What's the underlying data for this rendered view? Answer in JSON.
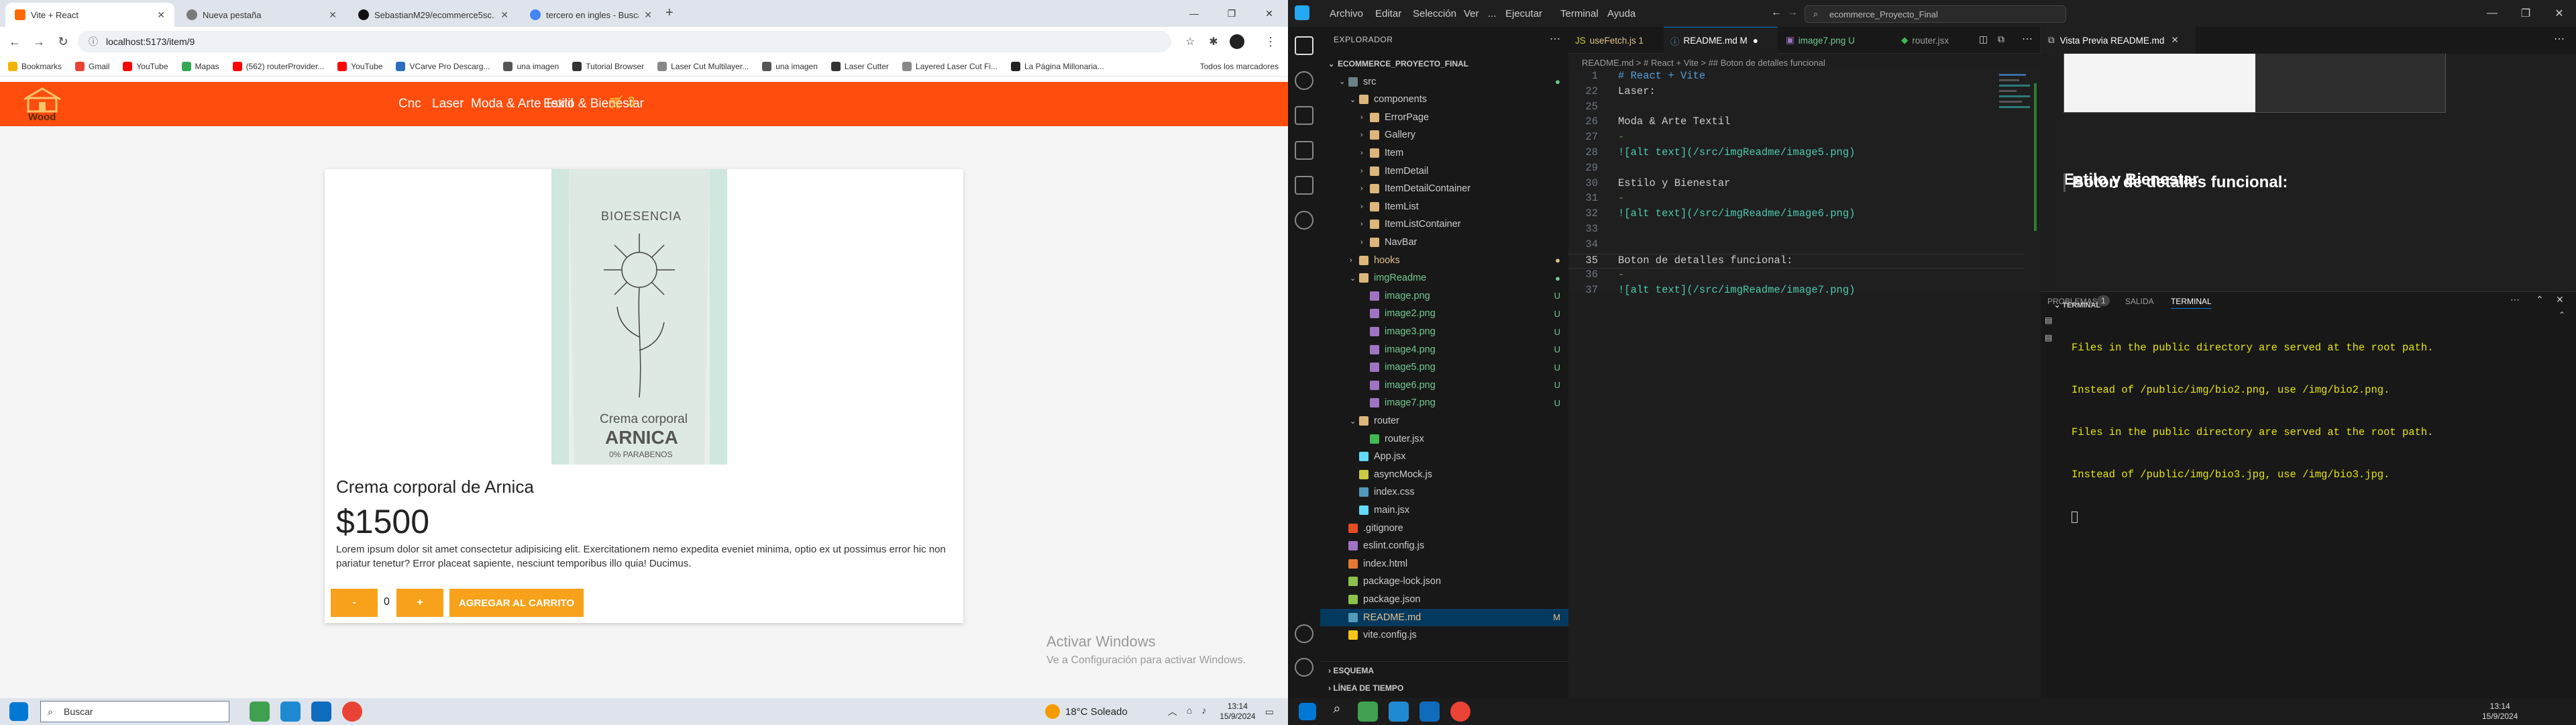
{
  "chrome": {
    "tabs": [
      {
        "label": "Vite + React",
        "color": "#ff6a00"
      },
      {
        "label": "Nueva pestaña",
        "color": "#7a7a7a"
      },
      {
        "label": "SebastianM29/ecommerce5sc...",
        "color": "#111111"
      },
      {
        "label": "tercero en ingles - Buscar con...",
        "color": "#4285f4"
      }
    ],
    "new_tab": "+",
    "url": "localhost:5173/item/9",
    "bookmarks": [
      {
        "label": "Bookmarks",
        "color": "#f2b400"
      },
      {
        "label": "Gmail",
        "color": "#ea4335"
      },
      {
        "label": "YouTube",
        "color": "#ff0000"
      },
      {
        "label": "Mapas",
        "color": "#34a853"
      },
      {
        "label": "(562) routerProvider...",
        "color": "#ff0000"
      },
      {
        "label": "YouTube",
        "color": "#ff0000"
      },
      {
        "label": "VCarve Pro Descarg...",
        "color": "#2a6ebb"
      },
      {
        "label": "una imagen",
        "color": "#555555"
      },
      {
        "label": "Tutorial Browser",
        "color": "#333333"
      },
      {
        "label": "Laser Cut Multilayer...",
        "color": "#888888"
      },
      {
        "label": "una imagen",
        "color": "#555555"
      },
      {
        "label": "Laser Cutter",
        "color": "#333333"
      },
      {
        "label": "Layered Laser Cut Fi...",
        "color": "#888888"
      },
      {
        "label": "La Página Millonaria...",
        "color": "#222222"
      }
    ],
    "bookmarks_all": "Todos los marcadores"
  },
  "site": {
    "brand": "Wood",
    "nav": [
      "Cnc",
      "Laser",
      "Moda & Arte Textil",
      "Estilo & Bienestar"
    ],
    "cart_count": "3",
    "product": {
      "image_brand": "BIOESENCIA",
      "image_text1": "Crema corporal",
      "image_text2": "ARNICA",
      "image_text3": "0% PARABENOS",
      "name": "Crema corporal de Arnica",
      "price": "$1500",
      "description": "Lorem ipsum dolor sit amet consectetur adipisicing elit. Exercitationem nemo expedita eveniet minima, optio ex ut possimus error hic non pariatur tenetur? Error placeat sapiente, nesciunt temporibus illo quia! Ducimus.",
      "minus": "-",
      "quantity": "0",
      "plus": "+",
      "add_to_cart": "AGREGAR AL CARRITO"
    },
    "watermark_title": "Activar Windows",
    "watermark_sub": "Ve a Configuración para activar Windows."
  },
  "taskbar_left": {
    "search": "Buscar",
    "weather": "18°C   Soleado",
    "time": "13:14",
    "date": "15/9/2024"
  },
  "taskbar_right": {
    "time": "13:14",
    "date": "15/9/2024"
  },
  "vscode": {
    "menu": [
      "Archivo",
      "Editar",
      "Selección",
      "Ver",
      "...",
      "Ejecutar",
      "Terminal",
      "Ayuda"
    ],
    "command_center": "ecommerce_Proyecto_Final",
    "explorer_title": "EXPLORADOR",
    "tree": [
      {
        "label": "ECOMMERCE_PROYECTO_FINAL",
        "indent": 0,
        "color": "#cccccc",
        "badge": "",
        "icon": "#cccccc"
      },
      {
        "label": "src",
        "indent": 1,
        "color": "#cccccc",
        "badge": "●",
        "badgeColor": "#73c991",
        "icon": "#6d8086"
      },
      {
        "label": "components",
        "indent": 2,
        "color": "#cccccc",
        "badge": "",
        "icon": "#dcb67a"
      },
      {
        "label": "ErrorPage",
        "indent": 3,
        "color": "#cccccc",
        "badge": "",
        "icon": "#dcb67a"
      },
      {
        "label": "Gallery",
        "indent": 3,
        "color": "#cccccc",
        "badge": "",
        "icon": "#dcb67a"
      },
      {
        "label": "Item",
        "indent": 3,
        "color": "#cccccc",
        "badge": "",
        "icon": "#dcb67a"
      },
      {
        "label": "ItemDetail",
        "indent": 3,
        "color": "#cccccc",
        "badge": "",
        "icon": "#dcb67a"
      },
      {
        "label": "ItemDetailContainer",
        "indent": 3,
        "color": "#cccccc",
        "badge": "",
        "icon": "#dcb67a"
      },
      {
        "label": "ItemList",
        "indent": 3,
        "color": "#cccccc",
        "badge": "",
        "icon": "#dcb67a"
      },
      {
        "label": "ItemListContainer",
        "indent": 3,
        "color": "#cccccc",
        "badge": "",
        "icon": "#dcb67a"
      },
      {
        "label": "NavBar",
        "indent": 3,
        "color": "#cccccc",
        "badge": "",
        "icon": "#dcb67a"
      },
      {
        "label": "hooks",
        "indent": 2,
        "color": "#e2c08d",
        "badge": "●",
        "badgeColor": "#e2c08d",
        "icon": "#dcb67a"
      },
      {
        "label": "imgReadme",
        "indent": 2,
        "color": "#73c991",
        "badge": "●",
        "badgeColor": "#73c991",
        "icon": "#dcb67a"
      },
      {
        "label": "image.png",
        "indent": 3,
        "color": "#73c991",
        "badge": "U",
        "badgeColor": "#73c991",
        "icon": "#a074c4"
      },
      {
        "label": "image2.png",
        "indent": 3,
        "color": "#73c991",
        "badge": "U",
        "badgeColor": "#73c991",
        "icon": "#a074c4"
      },
      {
        "label": "image3.png",
        "indent": 3,
        "color": "#73c991",
        "badge": "U",
        "badgeColor": "#73c991",
        "icon": "#a074c4"
      },
      {
        "label": "image4.png",
        "indent": 3,
        "color": "#73c991",
        "badge": "U",
        "badgeColor": "#73c991",
        "icon": "#a074c4"
      },
      {
        "label": "image5.png",
        "indent": 3,
        "color": "#73c991",
        "badge": "U",
        "badgeColor": "#73c991",
        "icon": "#a074c4"
      },
      {
        "label": "image6.png",
        "indent": 3,
        "color": "#73c991",
        "badge": "U",
        "badgeColor": "#73c991",
        "icon": "#a074c4"
      },
      {
        "label": "image7.png",
        "indent": 3,
        "color": "#73c991",
        "badge": "U",
        "badgeColor": "#73c991",
        "icon": "#a074c4"
      },
      {
        "label": "router",
        "indent": 2,
        "color": "#cccccc",
        "badge": "",
        "icon": "#dcb67a"
      },
      {
        "label": "router.jsx",
        "indent": 3,
        "color": "#cccccc",
        "badge": "",
        "icon": "#3fb950"
      },
      {
        "label": "App.jsx",
        "indent": 2,
        "color": "#cccccc",
        "badge": "",
        "icon": "#61dafb"
      },
      {
        "label": "asyncMock.js",
        "indent": 2,
        "color": "#cccccc",
        "badge": "",
        "icon": "#cbcb41"
      },
      {
        "label": "index.css",
        "indent": 2,
        "color": "#cccccc",
        "badge": "",
        "icon": "#519aba"
      },
      {
        "label": "main.jsx",
        "indent": 2,
        "color": "#cccccc",
        "badge": "",
        "icon": "#61dafb"
      },
      {
        "label": ".gitignore",
        "indent": 1,
        "color": "#cccccc",
        "badge": "",
        "icon": "#e44d26"
      },
      {
        "label": "eslint.config.js",
        "indent": 1,
        "color": "#cccccc",
        "badge": "",
        "icon": "#a074c4"
      },
      {
        "label": "index.html",
        "indent": 1,
        "color": "#cccccc",
        "badge": "",
        "icon": "#e37933"
      },
      {
        "label": "package-lock.json",
        "indent": 1,
        "color": "#cccccc",
        "badge": "",
        "icon": "#8dc149"
      },
      {
        "label": "package.json",
        "indent": 1,
        "color": "#cccccc",
        "badge": "",
        "icon": "#8dc149"
      },
      {
        "label": "README.md",
        "indent": 1,
        "color": "#e2c08d",
        "badge": "M",
        "badgeColor": "#e2c08d",
        "icon": "#519aba"
      },
      {
        "label": "vite.config.js",
        "indent": 1,
        "color": "#cccccc",
        "badge": "",
        "icon": "#f5c518"
      }
    ],
    "outline": "ESQUEMA",
    "timeline": "LÍNEA DE TIEMPO",
    "editor_tabs": [
      {
        "label": "useFetch.js 1",
        "color": "#e2c08d"
      },
      {
        "label": "README.md M",
        "color": "#ffffff"
      },
      {
        "label": "image7.png U",
        "color": "#73c991"
      },
      {
        "label": "router.jsx",
        "color": "#9d9d9d"
      }
    ],
    "breadcrumb": "README.md  >  # React + Vite  >  ## Boton de detalles funcional",
    "code": [
      {
        "n": "1",
        "text": "# React + Vite"
      },
      {
        "n": "22",
        "text": "Laser:"
      },
      {
        "n": "25",
        "text": ""
      },
      {
        "n": "26",
        "text": "Moda & Arte Textil"
      },
      {
        "n": "27",
        "text": "-"
      },
      {
        "n": "28",
        "text": "![alt text](/src/imgReadme/image5.png)"
      },
      {
        "n": "29",
        "text": ""
      },
      {
        "n": "30",
        "text": "Estilo y Bienestar"
      },
      {
        "n": "31",
        "text": "-"
      },
      {
        "n": "32",
        "text": "![alt text](/src/imgReadme/image6.png)"
      },
      {
        "n": "33",
        "text": ""
      },
      {
        "n": "34",
        "text": ""
      },
      {
        "n": "35",
        "text": "Boton de detalles funcional:"
      },
      {
        "n": "36",
        "text": "-"
      },
      {
        "n": "37",
        "text": "![alt text](/src/imgReadme/image7.png)"
      }
    ],
    "preview_tab": "Vista Previa README.md",
    "preview_heading1": "Estilo y Bienestar",
    "preview_heading2": "Boton de detalles funcional:",
    "panel_tabs": [
      "PROBLEMAS",
      "1",
      "SALIDA",
      "TERMINAL"
    ],
    "terminal_title": "TERMINAL",
    "terminal_lines": [
      "Files in the public directory are served at the root path.",
      "Instead of /public/img/bio2.png, use /img/bio2.png.",
      "Files in the public directory are served at the root path.",
      "Instead of /public/img/bio3.jpg, use /img/bio3.jpg."
    ]
  }
}
